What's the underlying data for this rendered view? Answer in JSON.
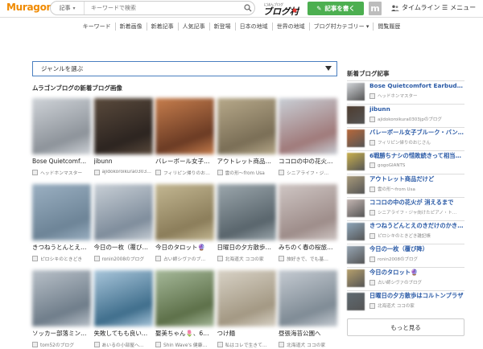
{
  "header": {
    "logo": "Muragon",
    "search_category": "記事",
    "search_placeholder": "キーワードで検索",
    "write_label": "記事を書く",
    "m_logo": "m",
    "timeline_label": "タイムライン",
    "menu_label": "メニュー",
    "brand_small": "にほんブログ",
    "brand_main": "ブログ村"
  },
  "nav": [
    "キーワード",
    "新着画像",
    "新着記事",
    "人気記事",
    "新登場",
    "日本の地域",
    "世界の地域",
    "ブログ村カテゴリー ▾",
    "閲覧履歴"
  ],
  "genre_select": "ジャンルを選ぶ",
  "section_title": "ムラゴンブログの新着ブログ画像",
  "cards": [
    {
      "title": "Bose Quietcomf…",
      "author": "ヘッドホンマスター",
      "colors": [
        "#cfd3d8",
        "#8d939a"
      ]
    },
    {
      "title": "jibunn",
      "author": "ajidokoroikura0303j…",
      "colors": [
        "#5a4a3c",
        "#2c2420"
      ]
    },
    {
      "title": "バレーボール女子…",
      "author": "フィリピン帰りのおじさん",
      "colors": [
        "#c77e4d",
        "#6b3b24"
      ]
    },
    {
      "title": "アウトレット商品…",
      "author": "雲の形～from Usa",
      "colors": [
        "#b7a98a",
        "#7a6e56"
      ]
    },
    {
      "title": "ココロの中の花火…",
      "author": "シニアライフ・ジ…",
      "colors": [
        "#c9cfd6",
        "#a07a7a"
      ]
    },
    {
      "title": "きつねうとんとえ…",
      "author": "ピロシキのときどき",
      "colors": [
        "#9bb0c2",
        "#6d8497"
      ]
    },
    {
      "title": "今日の一枚（覆び…",
      "author": "ronin2008のブログ",
      "colors": [
        "#c8cfd6",
        "#7f8d9c"
      ]
    },
    {
      "title": "今日のタロット🔮",
      "author": "占い師シヴァのブ…",
      "colors": [
        "#c3b792",
        "#8b7d5a"
      ]
    },
    {
      "title": "日曜日の夕方散歩…",
      "author": "北海道犬 ココの家",
      "colors": [
        "#9ca7ad",
        "#59656c"
      ]
    },
    {
      "title": "みちのく春の桜旅…",
      "author": "旅好きで、でも基…",
      "colors": [
        "#cfc6c4",
        "#9e8d8a"
      ]
    },
    {
      "title": "ソッカー部落ミン…",
      "author": "tom52のブログ",
      "colors": [
        "#b9c1c9",
        "#6f7d8a"
      ]
    },
    {
      "title": "失敗してもも良いよ…",
      "author": "あいるの小部屋へ…",
      "colors": [
        "#a9c6db",
        "#3f6e8c"
      ]
    },
    {
      "title": "娶美ちゃん🌷、6歳…",
      "author": "Shin Wave's 健康…",
      "colors": [
        "#a6b99a",
        "#5d7049"
      ]
    },
    {
      "title": "つけ麺",
      "author": "私はコレで生きて…",
      "colors": [
        "#d8d2c6",
        "#a39883"
      ]
    },
    {
      "title": "昼張海苔公園へ",
      "author": "北海道犬 ココの家",
      "colors": [
        "#c5cbd2",
        "#7f8b95"
      ]
    }
  ],
  "sidebar": {
    "title": "新着ブログ記事",
    "items": [
      {
        "title": "Bose Quietcomfort Earbuds 左…",
        "author": "ヘッドホンマスター",
        "color": "#d3d6da"
      },
      {
        "title": "jibunn",
        "author": "ajidokoroikura0303jpのブログ",
        "color": "#4e3c2f"
      },
      {
        "title": "バレーボール女子ブルーク・バン…",
        "author": "フィリピン帰りのおじさん",
        "color": "#b8683a"
      },
      {
        "title": "6戦勝ちナシの惜敗続きって相当…",
        "author": "gogoGIANTS",
        "color": "#c9b04e"
      },
      {
        "title": "アウトレット商品だけど",
        "author": "雲の形～from Usa",
        "color": "#a89a7a"
      },
      {
        "title": "ココロの中の花火が 消えるまで",
        "author": "シニアライフ・ジャ向けたピアノ・ト…",
        "color": "#c4b6b2"
      },
      {
        "title": "きつねうどんとえのきだけのかき…",
        "author": "ピロシキのときどき雑記帳",
        "color": "#8ea6ba"
      },
      {
        "title": "今日の一枚（覆び降）",
        "author": "ronin2008のブログ",
        "color": "#97a6b4"
      },
      {
        "title": "今日のタロット🔮",
        "author": "占い師シヴァのブログ",
        "color": "#b6a06c"
      },
      {
        "title": "日曜日の夕方散歩はコルトンプラザ",
        "author": "北海道犬 ココの家",
        "color": "#5f6a71"
      }
    ]
  },
  "more_label": "もっと見る",
  "colors": {
    "accent": "#4caf50",
    "logo": "#f08a00",
    "link": "#2a5aa6",
    "select_border": "#4a7fc0"
  }
}
